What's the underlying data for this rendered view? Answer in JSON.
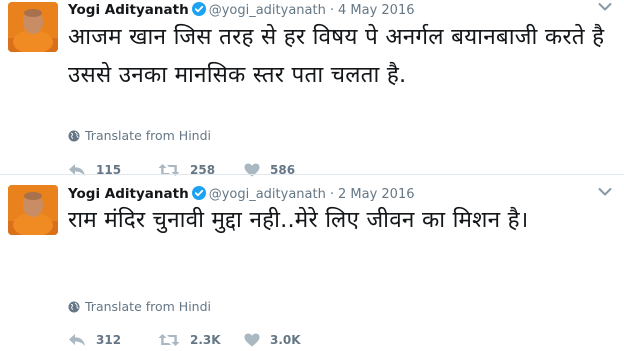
{
  "colors": {
    "text": "#14171a",
    "muted": "#657786",
    "verified": "#1da1f2",
    "icon": "#aab8c2",
    "divider": "#e1e8ed"
  },
  "icons": [
    "avatar",
    "verified-badge-icon",
    "chevron-down-icon",
    "globe-icon",
    "reply-icon",
    "retweet-icon",
    "heart-icon"
  ],
  "tweets": [
    {
      "name": "Yogi Adityanath",
      "handle": "@yogi_adityanath",
      "separator": "·",
      "date": "4 May 2016",
      "text": "आजम खान जिस तरह से हर विषय पे अनर्गल बयानबाजी करते है उससे उनका मानसिक स्तर पता चलता है.",
      "translate": "Translate from Hindi",
      "replies": "115",
      "retweets": "258",
      "likes": "586"
    },
    {
      "name": "Yogi Adityanath",
      "handle": "@yogi_adityanath",
      "separator": "·",
      "date": "2 May 2016",
      "text": "राम मंदिर चुनावी मुद्दा नही..मेरे लिए जीवन का मिशन है।",
      "translate": "Translate from Hindi",
      "replies": "312",
      "retweets": "2.3K",
      "likes": "3.0K"
    }
  ]
}
